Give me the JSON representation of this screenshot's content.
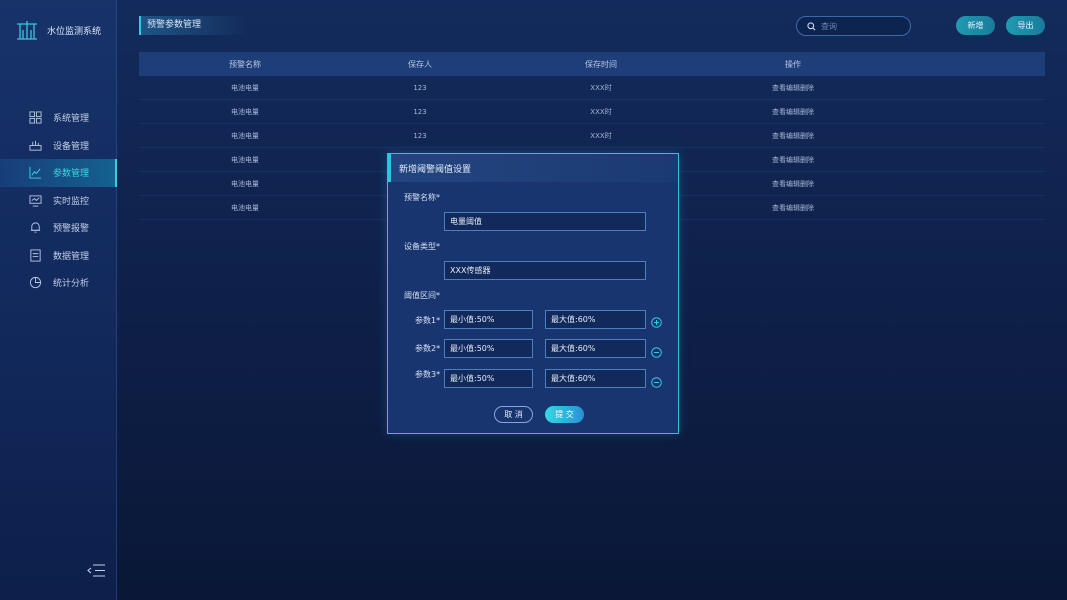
{
  "app": {
    "title": "水位监测系统"
  },
  "sidebar": {
    "items": [
      {
        "label": "系统管理",
        "icon": "grid-icon",
        "active": false
      },
      {
        "label": "设备管理",
        "icon": "device-icon",
        "active": false
      },
      {
        "label": "参数管理",
        "icon": "chart-line-icon",
        "active": true
      },
      {
        "label": "实时监控",
        "icon": "monitor-icon",
        "active": false
      },
      {
        "label": "预警报警",
        "icon": "bell-icon",
        "active": false
      },
      {
        "label": "数据管理",
        "icon": "document-icon",
        "active": false
      },
      {
        "label": "统计分析",
        "icon": "pie-chart-icon",
        "active": false
      }
    ]
  },
  "header": {
    "page_title": "预警参数管理",
    "search_placeholder": "查询",
    "add_label": "新增",
    "export_label": "导出"
  },
  "table": {
    "columns": [
      "预警名称",
      "保存人",
      "保存时间",
      "操作"
    ],
    "rows": [
      [
        "电池电量",
        "123",
        "XXX时",
        "查看编辑删除"
      ],
      [
        "电池电量",
        "123",
        "XXX时",
        "查看编辑删除"
      ],
      [
        "电池电量",
        "123",
        "XXX时",
        "查看编辑删除"
      ],
      [
        "电池电量",
        "",
        "",
        "查看编辑删除"
      ],
      [
        "电池电量",
        "",
        "",
        "查看编辑删除"
      ],
      [
        "电池电量",
        "",
        "",
        "查看编辑删除"
      ]
    ]
  },
  "modal": {
    "title": "新增阈警阈值设置",
    "name_label": "预警名称*",
    "name_value": "电量阈值",
    "type_label": "设备类型*",
    "type_value": "XXX传感器",
    "range_label": "阈值区间*",
    "params": [
      {
        "label": "参数1*",
        "min": "最小值:50%",
        "max": "最大值:60%",
        "action": "add"
      },
      {
        "label": "参数2*",
        "min": "最小值:50%",
        "max": "最大值:60%",
        "action": "remove"
      },
      {
        "label": "参数3*",
        "min": "最小值:50%",
        "max": "最大值:60%",
        "action": "remove"
      }
    ],
    "cancel_label": "取 消",
    "submit_label": "提 交"
  },
  "colors": {
    "accent": "#2ec6de",
    "bg": "#132b5c"
  }
}
